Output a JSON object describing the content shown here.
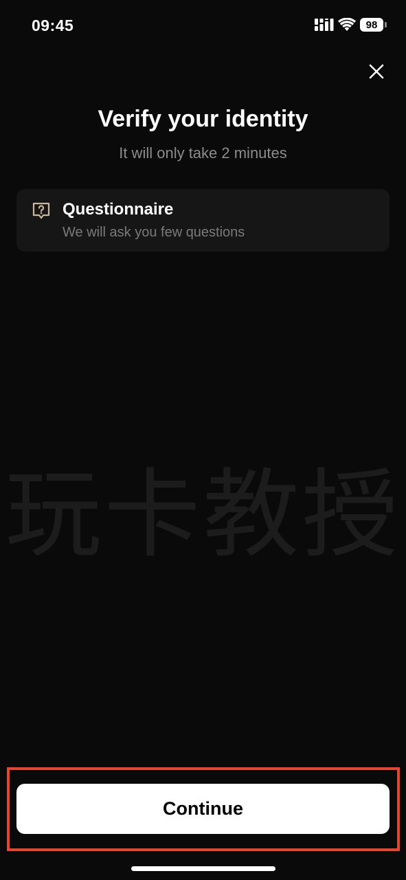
{
  "status_bar": {
    "time": "09:45",
    "battery": "98",
    "icons": [
      "signal-icon",
      "wifi-icon",
      "battery-icon"
    ]
  },
  "header": {
    "close_icon": "close-icon"
  },
  "main": {
    "title": "Verify your identity",
    "subtitle": "It will only take 2 minutes",
    "steps": [
      {
        "icon": "question-bubble-icon",
        "title": "Questionnaire",
        "description": "We will ask you few questions"
      }
    ]
  },
  "watermark": "玩卡教授",
  "footer": {
    "continue_label": "Continue"
  },
  "colors": {
    "background": "#0a0a0a",
    "card": "#161616",
    "icon_accent": "#c9b99a",
    "highlight": "#e8452f",
    "button": "#ffffff"
  }
}
